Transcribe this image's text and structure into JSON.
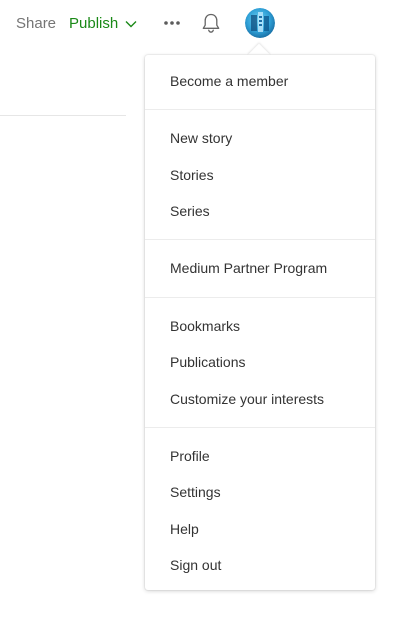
{
  "topbar": {
    "share_label": "Share",
    "publish_label": "Publish",
    "more_icon": "more-horizontal-icon",
    "bell_icon": "bell-icon",
    "accent_color": "#1a8917"
  },
  "menu": {
    "become_member": "Become a member",
    "new_story": "New story",
    "stories": "Stories",
    "series": "Series",
    "partner_program": "Medium Partner Program",
    "bookmarks": "Bookmarks",
    "publications": "Publications",
    "customize_interests": "Customize your interests",
    "profile": "Profile",
    "settings": "Settings",
    "help": "Help",
    "sign_out": "Sign out"
  }
}
